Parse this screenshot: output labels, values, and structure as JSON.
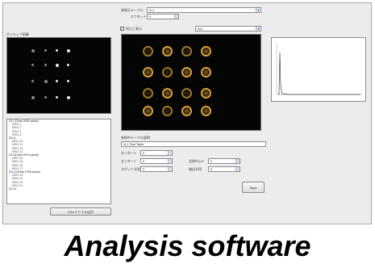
{
  "top": {
    "ref_table_label": "参照元テーブル",
    "ref_table_value": "A-1",
    "offset_label": "オフセット",
    "offset_value": "0",
    "same_display_label": "同じに表示",
    "same_display_checked": true,
    "same_display_select": "ALL"
  },
  "left": {
    "image_panel_label": "ポジティブ画像",
    "list_rows": [
      {
        "text": "D2-7(Total 2000 pixels)",
        "indent": false
      },
      {
        "text": "MSO-1",
        "indent": true
      },
      {
        "text": "MSO-2",
        "indent": true
      },
      {
        "text": "MSO-3",
        "indent": true
      },
      {
        "text": "MSO-4",
        "indent": true
      },
      {
        "text": "D2-8",
        "indent": false
      },
      {
        "text": "MSO-10",
        "indent": true
      },
      {
        "text": "MSO-11",
        "indent": true
      },
      {
        "text": "MSO-12",
        "indent": true
      },
      {
        "text": "MSO-13",
        "indent": true
      },
      {
        "text": "D2-9(Total 2074 pixels)",
        "indent": false
      },
      {
        "text": "MSO-14",
        "indent": true
      },
      {
        "text": "MSO-15",
        "indent": true
      },
      {
        "text": "MSO-16",
        "indent": true
      },
      {
        "text": "MSO-17",
        "indent": true
      },
      {
        "text": "D2-10(Total 1795 pixels)",
        "indent": false
      },
      {
        "text": "MSO-18",
        "indent": true
      },
      {
        "text": "MSO-19",
        "indent": true
      },
      {
        "text": "MSO-20",
        "indent": true
      },
      {
        "text": "MSO-21",
        "indent": true
      },
      {
        "text": "D2-11",
        "indent": false
      }
    ],
    "output_button": "CSVファイル出力"
  },
  "middle": {
    "comment_label": "参照中テーブル説明",
    "comment_value": "N-1 Test Table",
    "fields": [
      {
        "label": "センターX",
        "value": "0"
      },
      {
        "label": "センターY",
        "value": "0"
      },
      {
        "label": "スポット半径",
        "value": "0"
      }
    ],
    "fields_right": [
      {
        "label": "全体中心X",
        "value": "0"
      },
      {
        "label": "検出半径",
        "value": "0"
      }
    ],
    "save_button": "Save"
  },
  "banner": "Analysis software"
}
